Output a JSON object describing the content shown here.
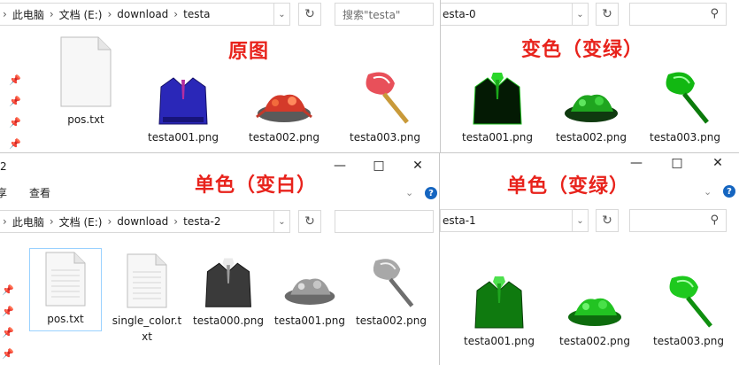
{
  "top_left": {
    "breadcrumb": [
      "此电脑",
      "文档 (E:)",
      "download",
      "testa"
    ],
    "search_placeholder": "搜索\"testa\"",
    "overlay": "原图",
    "files": [
      {
        "name": "pos.txt",
        "kind": "txt"
      },
      {
        "name": "testa001.png",
        "kind": "suit-blue"
      },
      {
        "name": "testa002.png",
        "kind": "crab-red"
      },
      {
        "name": "testa003.png",
        "kind": "fan-red"
      }
    ]
  },
  "top_right": {
    "breadcrumb": [
      "esta-0"
    ],
    "overlay": "变色（变绿）",
    "files": [
      {
        "name": "testa001.png",
        "kind": "suit-green-dark"
      },
      {
        "name": "testa002.png",
        "kind": "crab-green"
      },
      {
        "name": "testa003.png",
        "kind": "fan-green"
      }
    ]
  },
  "bottom_left": {
    "title_fragment": "2",
    "ribbon_tabs": [
      "享",
      "查看"
    ],
    "breadcrumb": [
      "此电脑",
      "文档 (E:)",
      "download",
      "testa-2"
    ],
    "overlay": "单色（变白）",
    "files": [
      {
        "name": "pos.txt",
        "kind": "txt",
        "selected": true
      },
      {
        "name": "single_color.txt",
        "kind": "txt"
      },
      {
        "name": "testa000.png",
        "kind": "suit-gray"
      },
      {
        "name": "testa001.png",
        "kind": "crab-gray"
      },
      {
        "name": "testa002.png",
        "kind": "fan-gray"
      }
    ]
  },
  "bottom_right": {
    "breadcrumb": [
      "esta-1"
    ],
    "overlay": "单色（变绿）",
    "files": [
      {
        "name": "testa001.png",
        "kind": "suit-green"
      },
      {
        "name": "testa002.png",
        "kind": "crab-green2"
      },
      {
        "name": "testa003.png",
        "kind": "fan-green2"
      }
    ]
  },
  "colors": {
    "accent_red": "#e8231c",
    "select_outline": "#99d1ff",
    "help_blue": "#1565c0"
  }
}
